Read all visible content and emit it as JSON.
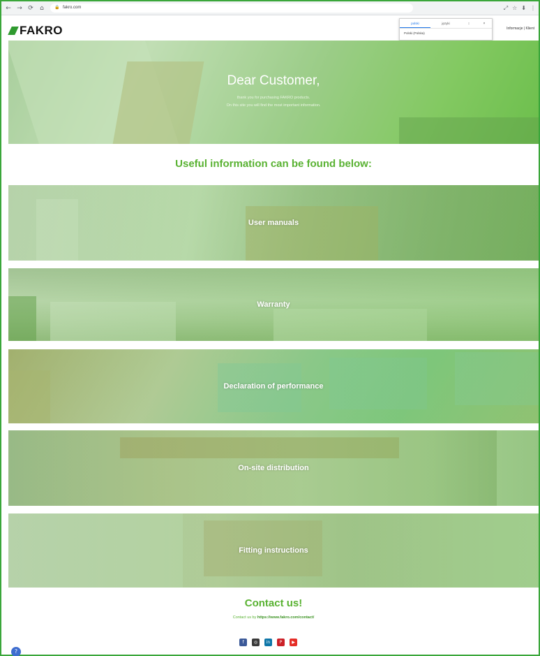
{
  "browser": {
    "address": "fakro.com",
    "nav_icons": [
      "←",
      "→",
      "⟳",
      "⌂"
    ],
    "right_icons": [
      "⤢",
      "☆",
      "⬇",
      "⋮"
    ]
  },
  "header": {
    "logo_text": "FAKRO",
    "right_text": "Informacje | Klient"
  },
  "popup": {
    "tabs": [
      "polski",
      "języki"
    ],
    "controls": [
      "↕",
      "×"
    ],
    "item": "Polski (Polska)"
  },
  "hero": {
    "title": "Dear Customer,",
    "subtitle_line1": "thank you for purchasing FAKRO products.",
    "subtitle_line2": "On this site you will find the most important information."
  },
  "useful_heading": "Useful information can be found below:",
  "tiles": [
    {
      "label": "User manuals"
    },
    {
      "label": "Warranty"
    },
    {
      "label": "Declaration of performance"
    },
    {
      "label": "On-site distribution"
    },
    {
      "label": "Fitting instructions"
    }
  ],
  "contact": {
    "title": "Contact us!",
    "line_prefix": "Contact us by",
    "link": "https://www.fakro.com/contact/"
  },
  "socials": [
    {
      "name": "facebook-icon",
      "glyph": "f",
      "color": "#3b5998"
    },
    {
      "name": "instagram-icon",
      "glyph": "◎",
      "color": "#3a3a3a"
    },
    {
      "name": "linkedin-icon",
      "glyph": "in",
      "color": "#0e76a8"
    },
    {
      "name": "pinterest-icon",
      "glyph": "P",
      "color": "#cb2027"
    },
    {
      "name": "youtube-icon",
      "glyph": "▶",
      "color": "#e52d27"
    }
  ],
  "help_glyph": "?",
  "colors": {
    "brand_green": "#59b232",
    "frame_green": "#3aa63a"
  }
}
